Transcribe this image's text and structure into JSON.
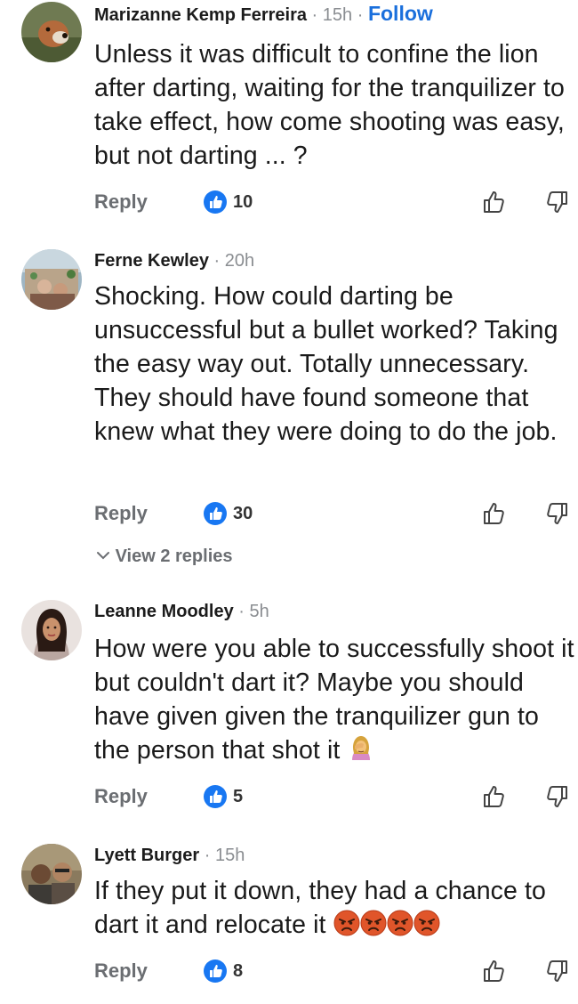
{
  "comments": [
    {
      "author": "Marizanne Kemp Ferreira",
      "separator": "·",
      "time": "15h",
      "follow": "Follow",
      "text": "Unless it was difficult to confine the lion after darting, waiting for the tranquilizer to take effect, how come shooting was easy, but not darting ... ?",
      "reply_label": "Reply",
      "likes": "10"
    },
    {
      "author": "Ferne Kewley",
      "separator": "·",
      "time": "20h",
      "text": "Shocking.  How could darting be unsuccessful but a bullet worked? Taking the easy way out. Totally unnecessary.  They should have found someone that knew what they were doing to do the job.",
      "reply_label": "Reply",
      "likes": "30",
      "view_replies": "View 2 replies"
    },
    {
      "author": "Leanne Moodley",
      "separator": "·",
      "time": "5h",
      "text": "How were you able to successfully shoot it but couldn't dart it? Maybe you should have given given the tranquilizer gun to the person that shot it",
      "reply_label": "Reply",
      "likes": "5"
    },
    {
      "author": "Lyett Burger",
      "separator": "·",
      "time": "15h",
      "text": "If they put it down, they had a chance to dart it and relocate it",
      "reply_label": "Reply",
      "likes": "8"
    }
  ],
  "icons": {
    "like_badge": "like-badge-icon",
    "thumb_up": "thumbs-up-icon",
    "thumb_down": "thumbs-down-icon",
    "chevron": "chevron-down-icon",
    "facepalm": "facepalm-emoji-icon",
    "angry": "angry-face-emoji-icon"
  },
  "colors": {
    "accent": "#1a6fdc",
    "muted": "#8a8d91",
    "reply": "#6b6e72"
  }
}
